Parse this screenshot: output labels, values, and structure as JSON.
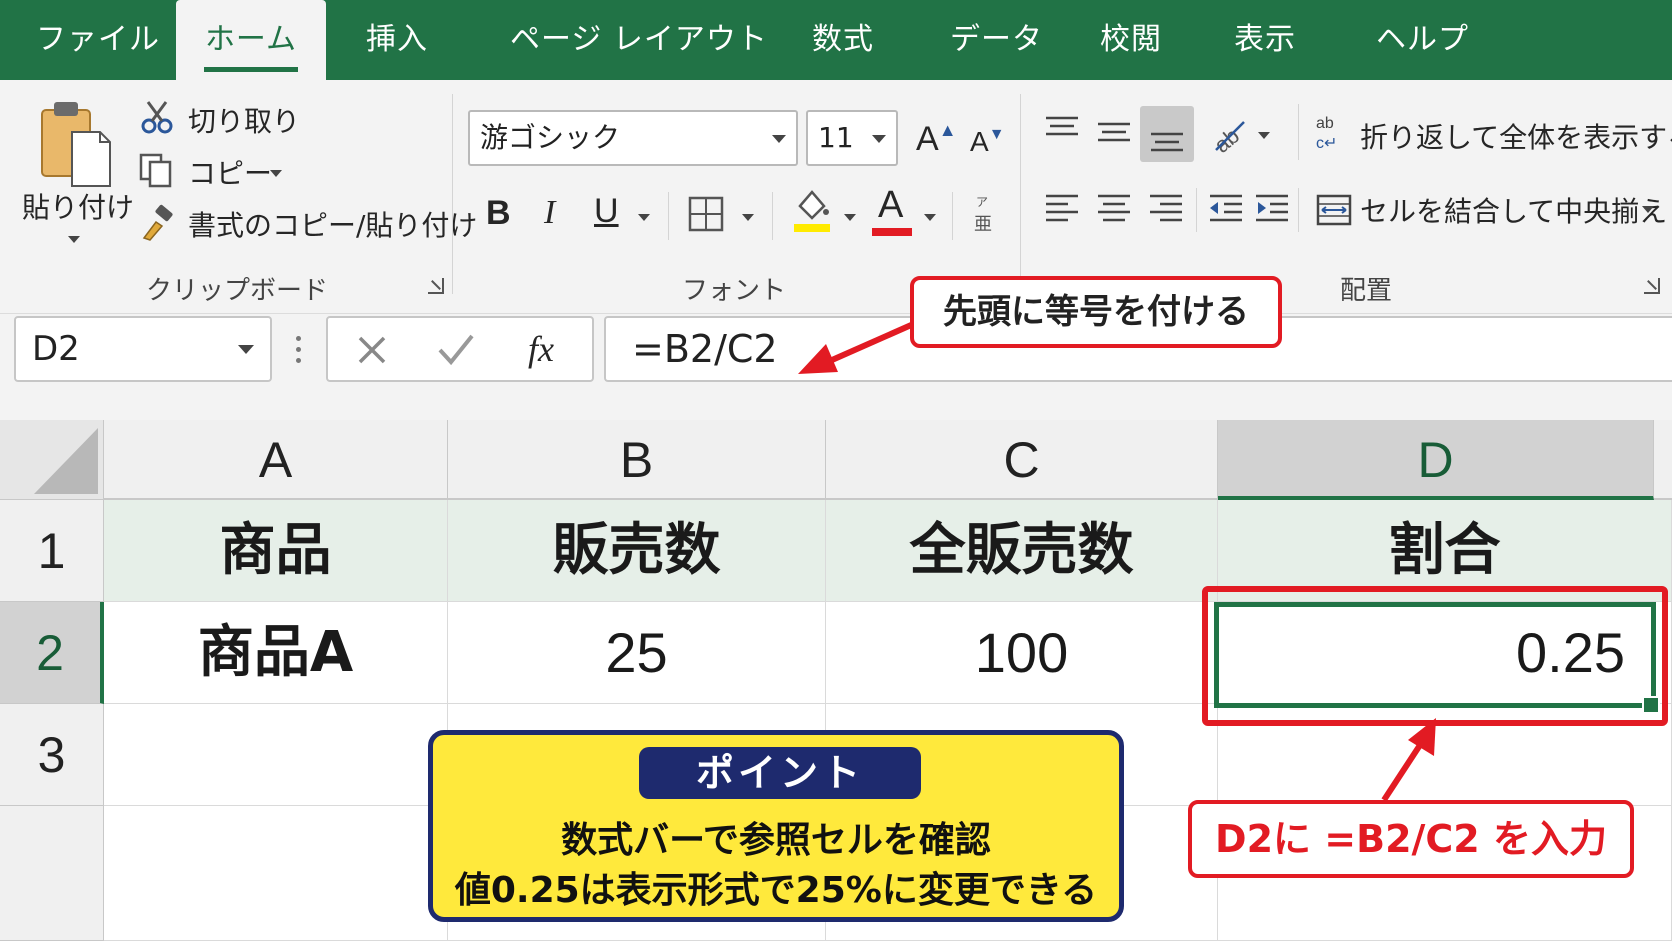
{
  "ribbon_tabs": [
    "ファイル",
    "ホーム",
    "挿入",
    "ページ レイアウト",
    "数式",
    "データ",
    "校閲",
    "表示",
    "ヘルプ"
  ],
  "active_tab": "ホーム",
  "clipboard": {
    "paste": "貼り付け",
    "cut": "切り取り",
    "copy": "コピー",
    "format_painter": "書式のコピー/貼り付け",
    "group_label": "クリップボード"
  },
  "font": {
    "name": "游ゴシック",
    "size": "11",
    "bold": "B",
    "italic": "I",
    "underline": "U",
    "grow": "A",
    "shrink": "A",
    "font_color_letter": "A",
    "group_label": "フォント",
    "highlight_color": "#ffeb00",
    "text_color": "#e21b23"
  },
  "alignment": {
    "wrap_text": "折り返して全体を表示する",
    "merge_center": "セルを結合して中央揃え",
    "group_label": "配置"
  },
  "formula_bar": {
    "name_box": "D2",
    "fx": "fx",
    "formula": "=B2/C2"
  },
  "sheet": {
    "columns": [
      "A",
      "B",
      "C",
      "D"
    ],
    "rows": [
      "1",
      "2",
      "3"
    ],
    "selected_cell": "D2",
    "cells": {
      "A1": "商品",
      "B1": "販売数",
      "C1": "全販売数",
      "D1": "割合",
      "A2": "商品A",
      "B2": "25",
      "C2": "100",
      "D2": "0.25"
    }
  },
  "annotations": {
    "formula_callout": "先頭に等号を付ける",
    "cell_callout": "D2に =B2/C2 を入力",
    "point_title": "ポイント",
    "point_line1": "数式バーで参照セルを確認",
    "point_line2": "値0.25は表示形式で25%に変更できる"
  },
  "colors": {
    "excel_green": "#217346",
    "callout_red": "#e21b23",
    "point_yellow": "#ffe93c",
    "point_navy": "#1e2a6e"
  }
}
